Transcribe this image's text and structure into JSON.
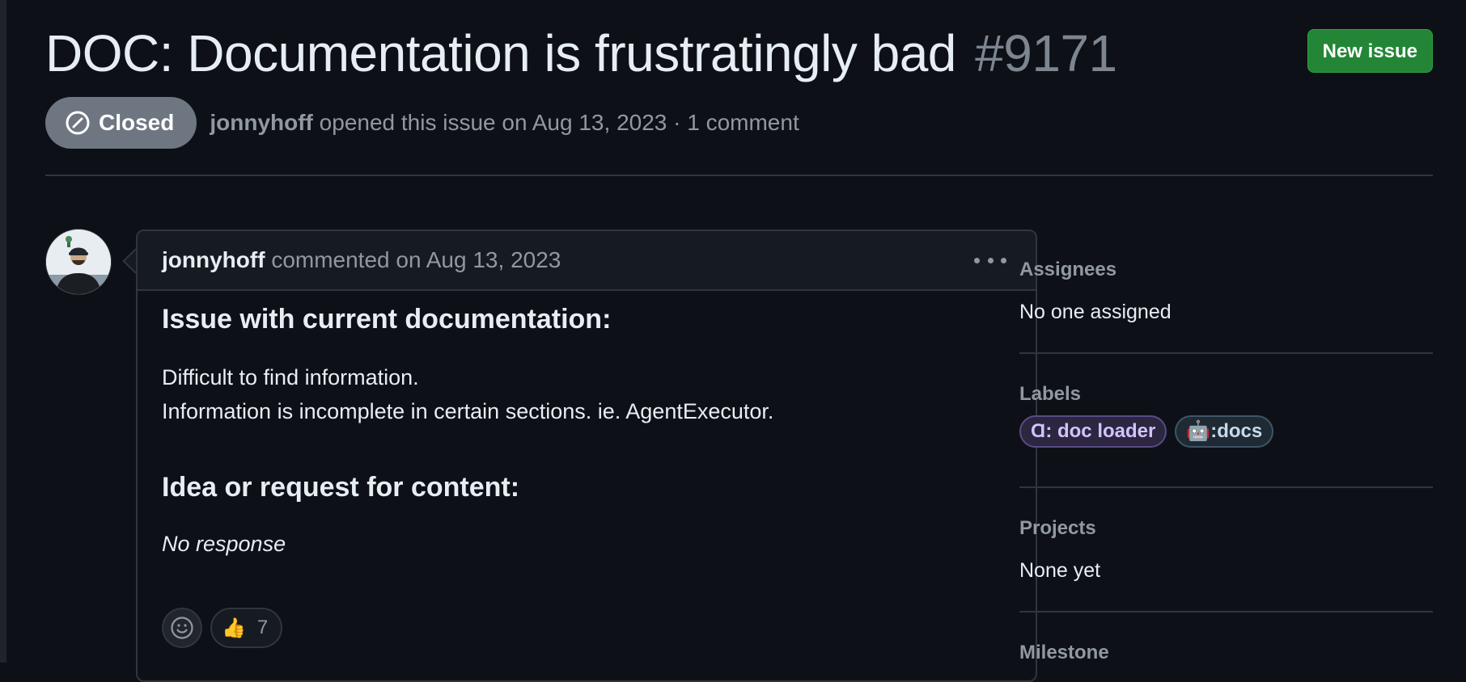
{
  "header": {
    "title": "DOC: Documentation is frustratingly bad",
    "number": "#9171",
    "new_issue_label": "New issue"
  },
  "meta": {
    "state": "Closed",
    "author": "jonnyhoff",
    "text": "opened this issue on Aug 13, 2023 · 1 comment"
  },
  "comment": {
    "author": "jonnyhoff",
    "header_text": "commented on Aug 13, 2023",
    "heading1": "Issue with current documentation:",
    "para_line1": "Difficult to find information.",
    "para_line2": "Information is incomplete in certain sections. ie. AgentExecutor.",
    "heading2": "Idea or request for content:",
    "no_response": "No response",
    "reaction_thumbs_emoji": "👍",
    "reaction_thumbs_count": "7"
  },
  "sidebar": {
    "assignees_heading": "Assignees",
    "assignees_value": "No one assigned",
    "labels_heading": "Labels",
    "labels": [
      "Ɑ: doc loader",
      "🤖:docs"
    ],
    "projects_heading": "Projects",
    "projects_value": "None yet",
    "milestone_heading": "Milestone"
  },
  "colors": {
    "background": "#0d1117",
    "new_issue_button": "#238636",
    "closed_badge": "#6e7681"
  }
}
